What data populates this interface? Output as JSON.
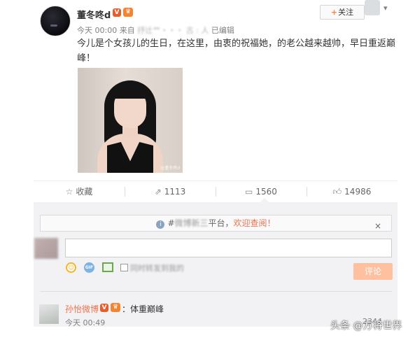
{
  "post": {
    "author": "董冬咚d",
    "verified_badge": "V",
    "member_badge": "♛",
    "time": "今天 00:00",
    "source_prefix": "来自",
    "source_redacted": "抒辻艹・・・ 古 : 人",
    "edited": "已编辑",
    "follow_label": "关注",
    "follow_plus": "+",
    "more_icon": "chevron-down-icon",
    "text": "今儿是个女孩儿的生日，在这里，由衷的祝福她，的老公越来越帅，早日重返巅峰！",
    "image_watermark": "@董冬咚d"
  },
  "actions": {
    "favorite_label": "收藏",
    "repost_count": "1113",
    "comment_count": "1560",
    "like_count": "14986"
  },
  "comment_box": {
    "notice_prefix": "#",
    "notice_redacted": "微博新三",
    "notice_middle": "平台，",
    "notice_link": "欢迎查阅！",
    "notice_close": "×",
    "input_value": "",
    "repost_option": "同时转发到我的",
    "submit_label": "评论"
  },
  "comments": [
    {
      "name": "孙怡微博",
      "separator": "：",
      "text": "体重巅峰",
      "time": "今天 00:49",
      "likes": "2344"
    }
  ],
  "watermark": "头条 @方将世界",
  "colors": {
    "accent": "#eb7350",
    "follow_plus": "#ff8140",
    "submit_bg": "#ffc09f",
    "panel_bg": "#f2f2f5"
  }
}
